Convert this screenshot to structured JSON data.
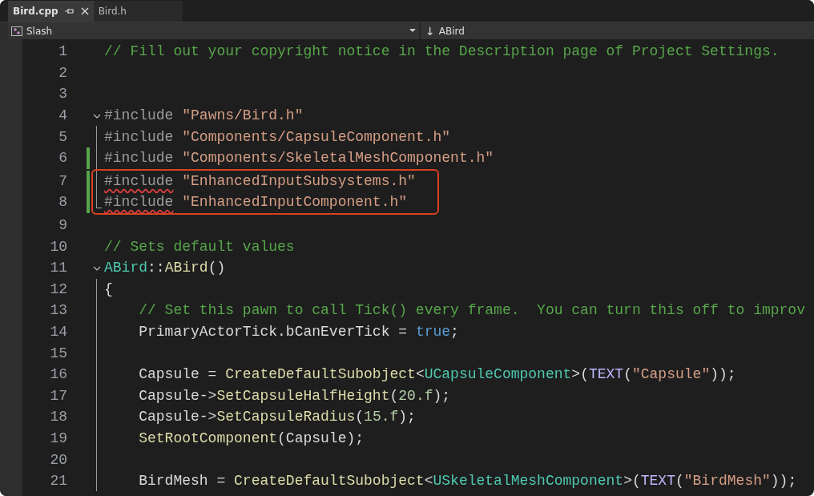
{
  "tabs": [
    {
      "label": "Bird.cpp",
      "selected": true
    },
    {
      "label": "Bird.h",
      "selected": false
    }
  ],
  "navbar": {
    "project": "Slash",
    "scope_arrow": "↓",
    "scope": "ABird"
  },
  "lines": [
    {
      "n": "1",
      "kind": "plain",
      "changed": false,
      "boxed": false,
      "tokens": [
        {
          "kind": "comment",
          "t": "// Fill out your copyright notice in the Description page of Project Settings."
        }
      ]
    },
    {
      "n": "2",
      "kind": "plain",
      "changed": false,
      "boxed": false
    },
    {
      "n": "3",
      "kind": "plain",
      "changed": false,
      "boxed": false
    },
    {
      "n": "4",
      "kind": "fold-start",
      "changed": false,
      "boxed": false,
      "tokens": [
        {
          "kind": "preproc",
          "t": "#include"
        },
        {
          "kind": "string",
          "t": " \"Pawns/Bird.h\""
        }
      ]
    },
    {
      "n": "5",
      "kind": "in-fold",
      "changed": false,
      "boxed": false,
      "tokens": [
        {
          "kind": "preproc",
          "t": "#include"
        },
        {
          "kind": "string",
          "t": " \"Components/CapsuleComponent.h\""
        }
      ]
    },
    {
      "n": "6",
      "kind": "in-fold",
      "changed": true,
      "boxed": false,
      "tokens": [
        {
          "kind": "preproc",
          "t": "#include"
        },
        {
          "kind": "string",
          "t": " \"Components/SkeletalMeshComponent.h\""
        }
      ]
    },
    {
      "n": "7",
      "kind": "in-fold",
      "changed": true,
      "boxed": true,
      "tokens": [
        {
          "kind": "preproc",
          "t": "#include",
          "squiggle": true
        },
        {
          "kind": "string",
          "t": " \"EnhancedInputSubsystems.h\""
        }
      ]
    },
    {
      "n": "8",
      "kind": "fold-end",
      "changed": true,
      "boxed": true,
      "tokens": [
        {
          "kind": "preproc",
          "t": "#include",
          "squiggle": true
        },
        {
          "kind": "string",
          "t": " \"EnhancedInputComponent.h\""
        }
      ]
    },
    {
      "n": "9",
      "kind": "plain",
      "changed": false,
      "boxed": false
    },
    {
      "n": "10",
      "kind": "plain",
      "changed": false,
      "boxed": false,
      "tokens": [
        {
          "kind": "comment",
          "t": "// Sets default values"
        }
      ]
    },
    {
      "n": "11",
      "kind": "fold-start",
      "changed": false,
      "boxed": false,
      "tokens": [
        {
          "kind": "type",
          "t": "ABird"
        },
        {
          "kind": "plain",
          "t": "::"
        },
        {
          "kind": "func",
          "t": "ABird"
        },
        {
          "kind": "plain",
          "t": "()"
        }
      ]
    },
    {
      "n": "12",
      "kind": "in-fold",
      "changed": false,
      "boxed": false,
      "tokens": [
        {
          "kind": "plain",
          "t": "{"
        }
      ]
    },
    {
      "n": "13",
      "kind": "in-fold",
      "changed": false,
      "boxed": false,
      "tokens": [
        {
          "kind": "comment",
          "t": "    // Set this pawn to call Tick() every frame.  You can turn this off to improv"
        }
      ]
    },
    {
      "n": "14",
      "kind": "in-fold",
      "changed": false,
      "boxed": false,
      "tokens": [
        {
          "kind": "plain",
          "t": "    PrimaryActorTick.bCanEverTick = "
        },
        {
          "kind": "keyword",
          "t": "true"
        },
        {
          "kind": "plain",
          "t": ";"
        }
      ]
    },
    {
      "n": "15",
      "kind": "in-fold",
      "changed": false,
      "boxed": false
    },
    {
      "n": "16",
      "kind": "in-fold",
      "changed": false,
      "boxed": false,
      "tokens": [
        {
          "kind": "plain",
          "t": "    Capsule = "
        },
        {
          "kind": "func",
          "t": "CreateDefaultSubobject"
        },
        {
          "kind": "plain",
          "t": "<"
        },
        {
          "kind": "type",
          "t": "UCapsuleComponent"
        },
        {
          "kind": "plain",
          "t": ">("
        },
        {
          "kind": "macro",
          "t": "TEXT"
        },
        {
          "kind": "plain",
          "t": "("
        },
        {
          "kind": "string",
          "t": "\"Capsule\""
        },
        {
          "kind": "plain",
          "t": "));"
        }
      ]
    },
    {
      "n": "17",
      "kind": "in-fold",
      "changed": false,
      "boxed": false,
      "tokens": [
        {
          "kind": "plain",
          "t": "    Capsule->"
        },
        {
          "kind": "func",
          "t": "SetCapsuleHalfHeight"
        },
        {
          "kind": "plain",
          "t": "("
        },
        {
          "kind": "number",
          "t": "20.f"
        },
        {
          "kind": "plain",
          "t": ");"
        }
      ]
    },
    {
      "n": "18",
      "kind": "in-fold",
      "changed": false,
      "boxed": false,
      "tokens": [
        {
          "kind": "plain",
          "t": "    Capsule->"
        },
        {
          "kind": "func",
          "t": "SetCapsuleRadius"
        },
        {
          "kind": "plain",
          "t": "("
        },
        {
          "kind": "number",
          "t": "15.f"
        },
        {
          "kind": "plain",
          "t": ");"
        }
      ]
    },
    {
      "n": "19",
      "kind": "in-fold",
      "changed": false,
      "boxed": false,
      "tokens": [
        {
          "kind": "func",
          "t": "    SetRootComponent"
        },
        {
          "kind": "plain",
          "t": "(Capsule);"
        }
      ]
    },
    {
      "n": "20",
      "kind": "in-fold",
      "changed": false,
      "boxed": false
    },
    {
      "n": "21",
      "kind": "in-fold",
      "changed": false,
      "boxed": false,
      "tokens": [
        {
          "kind": "plain",
          "t": "    BirdMesh = "
        },
        {
          "kind": "func",
          "t": "CreateDefaultSubobject"
        },
        {
          "kind": "plain",
          "t": "<"
        },
        {
          "kind": "type",
          "t": "USkeletalMeshComponent"
        },
        {
          "kind": "plain",
          "t": ">("
        },
        {
          "kind": "macro",
          "t": "TEXT"
        },
        {
          "kind": "plain",
          "t": "("
        },
        {
          "kind": "string",
          "t": "\"BirdMesh\""
        },
        {
          "kind": "plain",
          "t": "));"
        }
      ]
    }
  ]
}
